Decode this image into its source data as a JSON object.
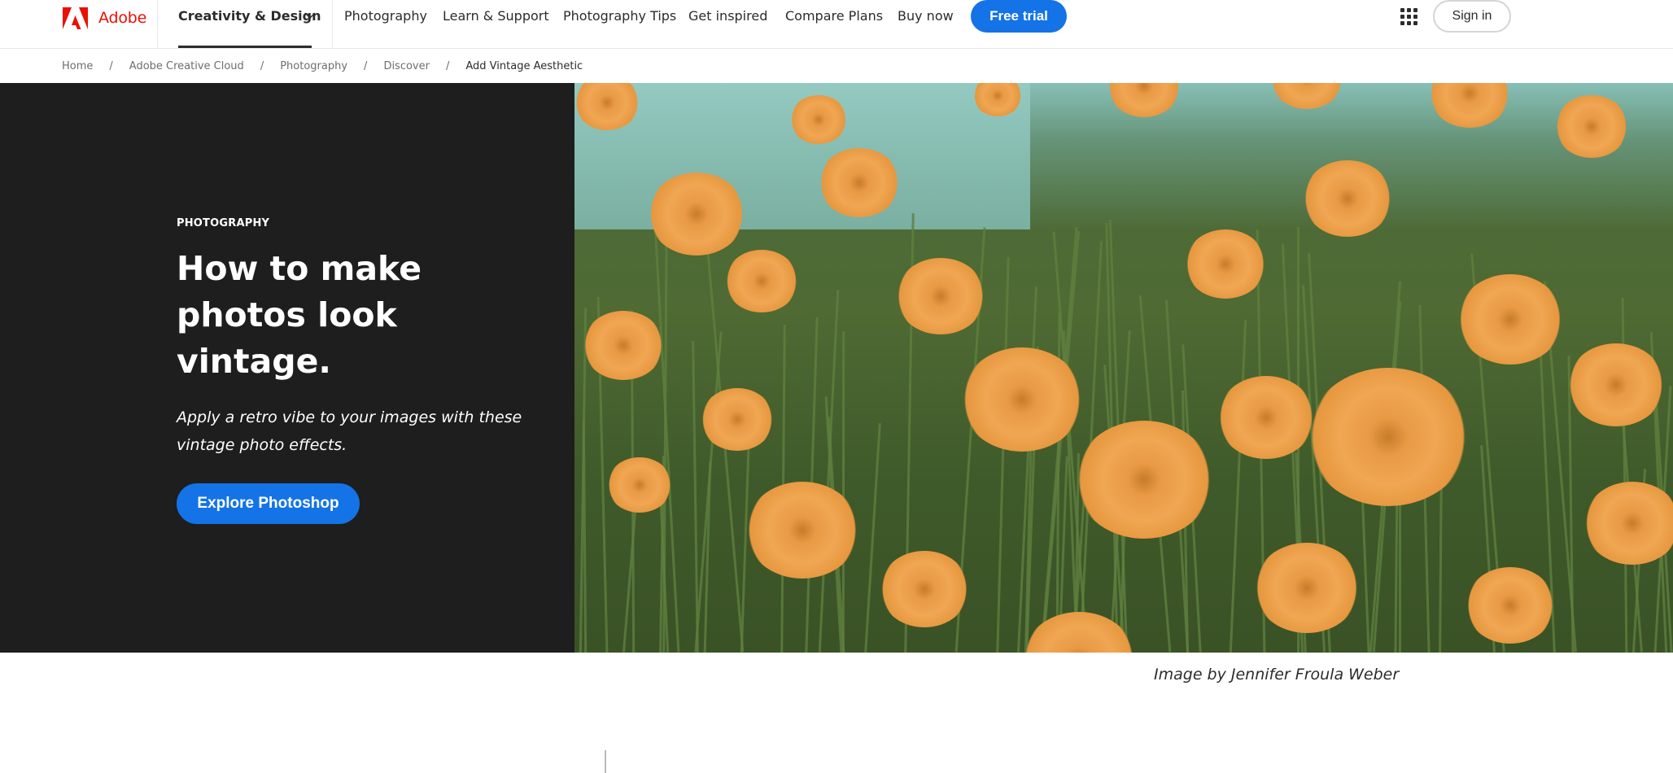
{
  "brand": {
    "name": "Adobe",
    "logo_icon": "adobe-logo-icon",
    "brand_color": "#eb1000",
    "accent_color": "#1473e6"
  },
  "nav": {
    "main_menu": {
      "label": "Creativity & Design",
      "icon": "chevron-down-icon"
    },
    "links": [
      {
        "label": "Photography"
      },
      {
        "label": "Learn & Support"
      },
      {
        "label": "Photography Tips"
      },
      {
        "label": "Get inspired"
      },
      {
        "label": "Compare Plans"
      },
      {
        "label": "Buy now"
      }
    ],
    "cta_label": "Free trial",
    "apps_icon": "app-switcher-grid-icon",
    "signin_label": "Sign in"
  },
  "breadcrumb": [
    {
      "label": "Home"
    },
    {
      "label": "Adobe Creative Cloud"
    },
    {
      "label": "Photography"
    },
    {
      "label": "Discover"
    },
    {
      "label": "Add Vintage Aesthetic"
    }
  ],
  "breadcrumb_separator": "/",
  "hero": {
    "eyebrow": "PHOTOGRAPHY",
    "title": "How to make photos look vintage.",
    "subtitle": "Apply a retro vibe to your images with these vintage photo effects.",
    "cta_label": "Explore Photoshop",
    "image_description": "Field of orange cosmos flowers against a teal sky with vintage color tone",
    "caption": "Image by Jennifer Froula Weber"
  }
}
